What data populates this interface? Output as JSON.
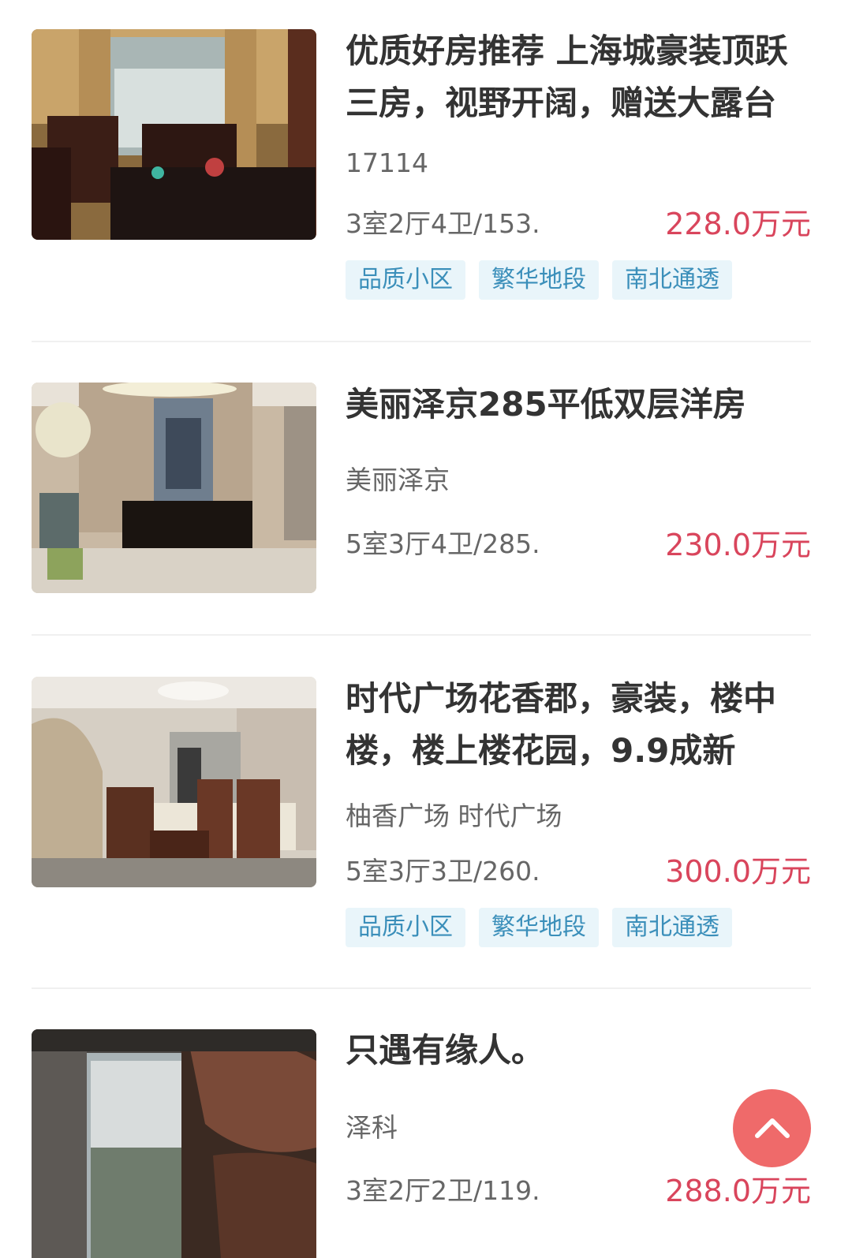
{
  "listings": [
    {
      "title": "优质好房推荐 上海城豪装顶跃三房，视野开阔，赠送大露台",
      "community": "17114",
      "layout": "3室2厅4卫/153.",
      "price": "228.0万元",
      "tags": [
        "品质小区",
        "繁华地段",
        "南北通透"
      ]
    },
    {
      "title": "美丽泽京285平低双层洋房",
      "community": "美丽泽京",
      "layout": "5室3厅4卫/285.",
      "price": "230.0万元",
      "tags": []
    },
    {
      "title": "时代广场花香郡，豪装，楼中楼，楼上楼花园，9.9成新",
      "community": "柚香广场 时代广场",
      "layout": "5室3厅3卫/260.",
      "price": "300.0万元",
      "tags": [
        "品质小区",
        "繁华地段",
        "南北通透"
      ]
    },
    {
      "title": "只遇有缘人。",
      "community": "泽科",
      "layout": "3室2厅2卫/119.",
      "price": "288.0万元",
      "tags": []
    }
  ],
  "icons": {
    "back_to_top": "chevron-up-icon"
  },
  "colors": {
    "price": "#d9455c",
    "tag_bg": "#e9f5fa",
    "tag_text": "#3b8fba",
    "back_to_top_bg": "#ef6a6a"
  }
}
